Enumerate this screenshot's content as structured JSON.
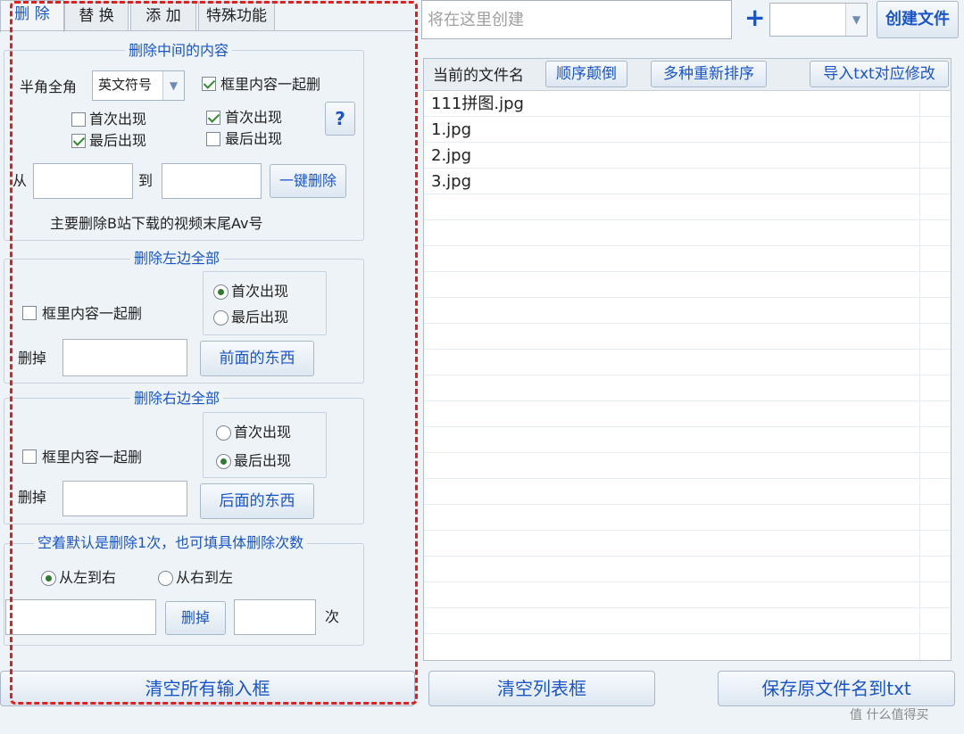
{
  "tabs": [
    {
      "label": "删 除"
    },
    {
      "label": "替 换"
    },
    {
      "label": "添 加"
    },
    {
      "label": "特殊功能"
    }
  ],
  "top": {
    "filename_placeholder": "将在这里创建",
    "plus_symbol": "+",
    "count_value": "",
    "create_button": "创建文件"
  },
  "delete_middle": {
    "title": "删除中间的内容",
    "halfwidth_label": "半角全角",
    "symbol_select": "英文符号",
    "include_box_label": "框里内容一起删",
    "include_box_checked": true,
    "left_first_label": "首次出现",
    "left_first_checked": false,
    "left_last_label": "最后出现",
    "left_last_checked": true,
    "right_first_label": "首次出现",
    "right_first_checked": true,
    "right_last_label": "最后出现",
    "right_last_checked": false,
    "help_button": "?",
    "from_label": "从",
    "to_label": "到",
    "one_click_button": "一键删除",
    "note": "主要删除B站下载的视频末尾Av号"
  },
  "delete_left": {
    "title": "删除左边全部",
    "include_box_label": "框里内容一起删",
    "include_box_checked": false,
    "first_label": "首次出现",
    "last_label": "最后出现",
    "selected": "first",
    "delete_label": "删掉",
    "front_button": "前面的东西"
  },
  "delete_right": {
    "title": "删除右边全部",
    "include_box_label": "框里内容一起删",
    "include_box_checked": false,
    "first_label": "首次出现",
    "last_label": "最后出现",
    "selected": "last",
    "delete_label": "删掉",
    "back_button": "后面的东西"
  },
  "delete_count": {
    "title": "空着默认是删除1次，也可填具体删除次数",
    "ltr_label": "从左到右",
    "rtl_label": "从右到左",
    "selected": "ltr",
    "delete_button": "删掉",
    "times_label": "次"
  },
  "list": {
    "header_label": "当前的文件名",
    "reverse_button": "顺序颠倒",
    "resort_button": "多种重新排序",
    "import_button": "导入txt对应修改",
    "rows": [
      "111拼图.jpg",
      "1.jpg",
      "2.jpg",
      "3.jpg"
    ]
  },
  "bottom": {
    "clear_inputs": "清空所有输入框",
    "clear_list": "清空列表框",
    "save_names": "保存原文件名到txt"
  },
  "watermark": {
    "text": "值 什么值得买"
  },
  "colors": {
    "accent_blue": "#1a55c8",
    "annotation_red": "#e02020",
    "background": "#eef3f7"
  }
}
